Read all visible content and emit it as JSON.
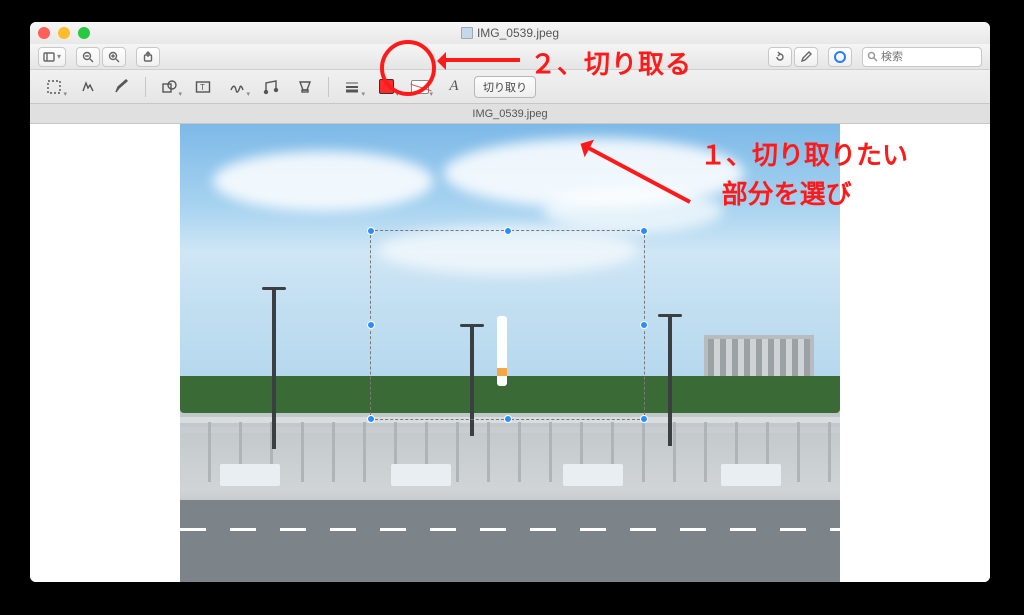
{
  "window": {
    "title": "IMG_0539.jpeg",
    "tab_label": "IMG_0539.jpeg"
  },
  "search": {
    "placeholder": "検索"
  },
  "markup": {
    "crop_label": "切り取り",
    "font_letter": "A"
  },
  "annotations": {
    "step2": "２、切り取る",
    "step1_line1": "１、切り取りたい",
    "step1_line2": "部分を選び"
  },
  "icons": {
    "sidebar": "sidebar",
    "zoom_out": "zoom-out",
    "zoom_in": "zoom-in",
    "share": "share",
    "rotate": "rotate",
    "edit": "pencil",
    "info": "at-symbol",
    "search": "magnifier",
    "select_rect": "selection-rect",
    "lasso": "lasso",
    "draw": "pencil-draw",
    "shapes": "shapes",
    "text": "text-box",
    "sign": "signature",
    "note": "note",
    "highlight": "highlight",
    "line_style": "line-weight",
    "color": "color",
    "fill": "fill",
    "font": "font-style"
  }
}
